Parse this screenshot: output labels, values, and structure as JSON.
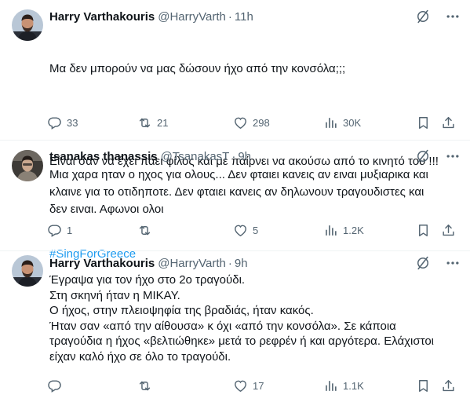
{
  "tweets": [
    {
      "name": "Harry Varthakouris",
      "handle": "@HarryVarth",
      "dot": "·",
      "time": "11h",
      "lines": [
        "Μα δεν μπορούν να μας δώσουν ήχο από την κονσόλα;;;",
        "",
        "Είναι σαν να έχει πάει φίλος και με παίρνει να ακούσω από το κινητό του !!!",
        ""
      ],
      "hashtag": "#SingForGreece",
      "replies": "33",
      "retweets": "21",
      "likes": "298",
      "views": "30K"
    },
    {
      "name": "tsanakas thanassis",
      "handle": "@TsanakasT",
      "dot": "·",
      "time": "9h",
      "text": "Μια χαρα ηταν ο ηχος για ολους... Δεν φταιει κανεις αν ειναι μυξιαρικα και\nκλαινε για το οτιδηποτε. Δεν φταιει κανεις αν δηλωνουν τραγουδιστες και\nδεν ειναι. Αφωνοι ολοι",
      "replies": "1",
      "retweets": "",
      "likes": "5",
      "views": "1.2K"
    },
    {
      "name": "Harry Varthakouris",
      "handle": "@HarryVarth",
      "dot": "·",
      "time": "9h",
      "text": "Έγραψα για τον ήχο στο 2ο τραγούδι.\nΣτη σκηνή ήταν η MIKAY.\nΟ ήχος, στην πλειοψηφία της βραδιάς, ήταν κακός.\nΉταν σαν «από την αίθουσα» κ όχι «από την κονσόλα». Σε κάποια\nτραγούδια η ήχος «βελτιώθηκε» μετά το ρεφρέν ή και αργότερα. Ελάχιστοι\nείχαν καλό ήχο σε όλο το τραγούδι.",
      "replies": "",
      "retweets": "",
      "likes": "17",
      "views": "1.1K"
    }
  ],
  "icons": {
    "grok": "grok-icon",
    "more": "more-icon",
    "reply": "reply-icon",
    "retweet": "retweet-icon",
    "like": "heart-icon",
    "views": "views-icon",
    "bookmark": "bookmark-icon",
    "share": "share-icon"
  },
  "colors": {
    "text": "#0f1419",
    "secondary": "#536471",
    "link": "#1d9bf0",
    "divider": "#eff3f4"
  }
}
